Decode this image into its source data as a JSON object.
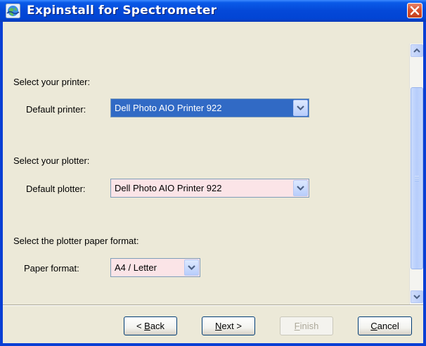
{
  "window": {
    "title": "Expinstall for Spectrometer"
  },
  "printer_section": {
    "heading": "Select your printer:",
    "field_label": "Default printer:",
    "selected_value": "Dell Photo AIO Printer 922"
  },
  "plotter_section": {
    "heading": "Select your plotter:",
    "field_label": "Default plotter:",
    "selected_value": "Dell Photo AIO Printer 922"
  },
  "paper_section": {
    "heading": "Select the plotter paper format:",
    "field_label": "Paper format:",
    "selected_value": "A4 / Letter"
  },
  "buttons": {
    "back": {
      "prefix": "< ",
      "mnemonic": "B",
      "rest": "ack"
    },
    "next": {
      "prefix": "",
      "mnemonic": "N",
      "rest": "ext >"
    },
    "finish": {
      "prefix": "",
      "mnemonic": "F",
      "rest": "inish"
    },
    "cancel": {
      "prefix": "",
      "mnemonic": "C",
      "rest": "ancel"
    }
  },
  "colors": {
    "titlebar": "#0a5ae8",
    "selection": "#316ac5",
    "required_field": "#fbe4e7"
  }
}
